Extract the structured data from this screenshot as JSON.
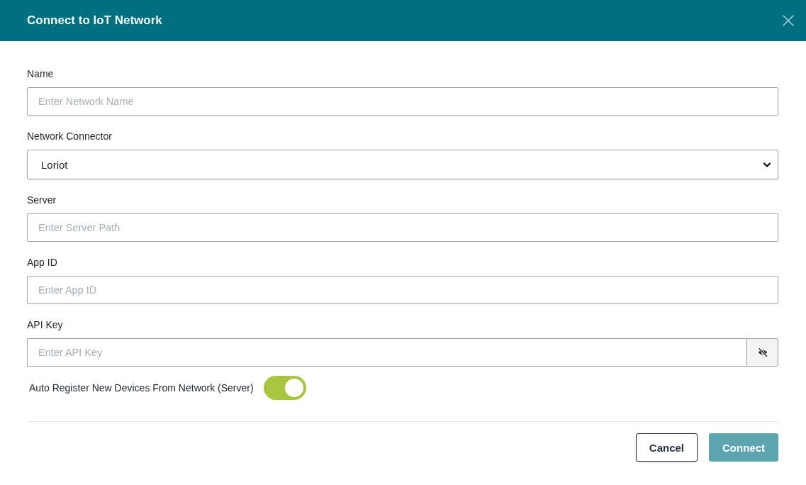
{
  "dialog": {
    "title": "Connect to IoT Network"
  },
  "fields": [
    {
      "kind": "text",
      "label": "Name",
      "placeholder": "Enter Network Name"
    },
    {
      "kind": "select",
      "label": "Network Connector",
      "value": "Loriot"
    },
    {
      "kind": "text",
      "label": "Server",
      "placeholder": "Enter Server Path"
    },
    {
      "kind": "text",
      "label": "App ID",
      "placeholder": "Enter App ID"
    },
    {
      "kind": "password",
      "label": "API Key",
      "placeholder": "Enter API Key"
    }
  ],
  "auto_register": {
    "label": "Auto Register New Devices From Network (Server)",
    "on": true
  },
  "buttons": [
    {
      "label": "Cancel",
      "kind": "outline",
      "disabled": false
    },
    {
      "label": "Connect",
      "kind": "primary",
      "disabled": true
    }
  ]
}
